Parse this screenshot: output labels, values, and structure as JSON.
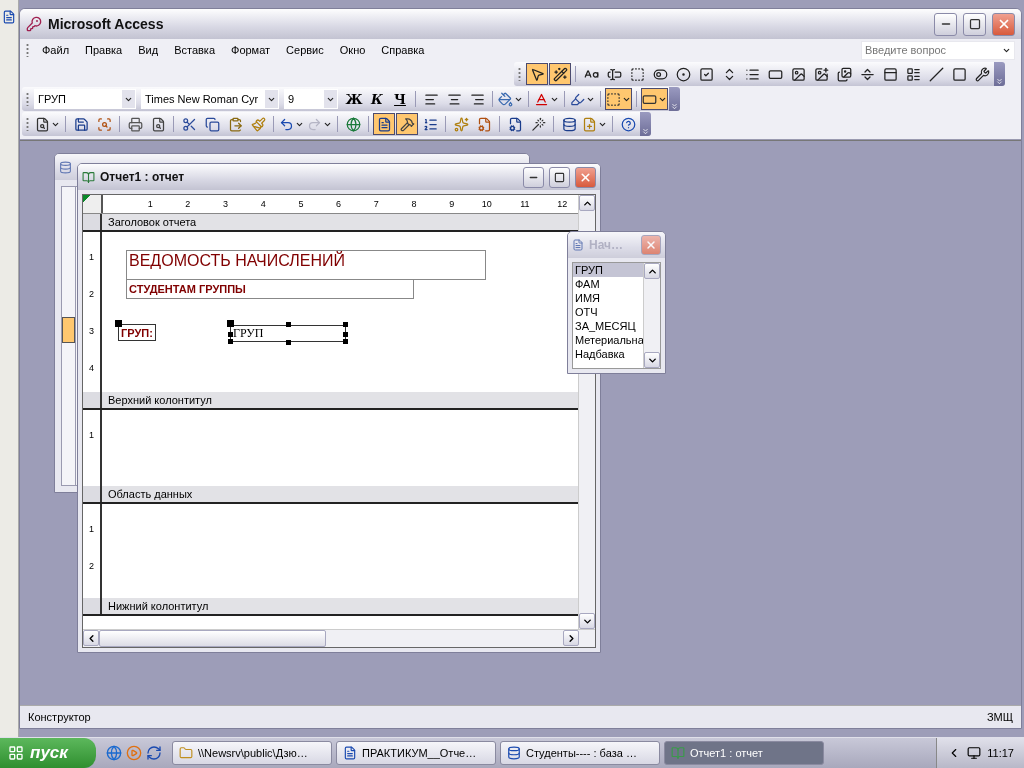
{
  "window": {
    "title": "Microsoft Access"
  },
  "menu": [
    "Файл",
    "Правка",
    "Вид",
    "Вставка",
    "Формат",
    "Сервис",
    "Окно",
    "Справка"
  ],
  "help_search": {
    "placeholder": "Введите вопрос"
  },
  "toolbox": [
    {
      "kind": "pointer",
      "selected": true
    },
    {
      "kind": "wizard",
      "selected": true
    },
    {
      "kind": "label",
      "selected": false
    },
    {
      "kind": "textbox",
      "selected": false
    },
    {
      "kind": "option-group",
      "selected": false
    },
    {
      "kind": "toggle",
      "selected": false
    },
    {
      "kind": "radio",
      "selected": false
    },
    {
      "kind": "checkbox",
      "selected": false
    },
    {
      "kind": "combo",
      "selected": false
    },
    {
      "kind": "listbox",
      "selected": false
    },
    {
      "kind": "command",
      "selected": false
    },
    {
      "kind": "image",
      "selected": false
    },
    {
      "kind": "unbound-frame",
      "selected": false
    },
    {
      "kind": "bound-frame",
      "selected": false
    },
    {
      "kind": "page-break",
      "selected": false
    },
    {
      "kind": "tab-control",
      "selected": false
    },
    {
      "kind": "subform",
      "selected": false
    },
    {
      "kind": "line",
      "selected": false
    },
    {
      "kind": "rectangle",
      "selected": false
    },
    {
      "kind": "more-tools",
      "selected": false
    }
  ],
  "formatting": {
    "object": "ГРУП",
    "font": "Times New Roman Cyr",
    "size": "9",
    "styles": [
      {
        "label": "Ж",
        "kind": "bold"
      },
      {
        "label": "К",
        "kind": "italic"
      },
      {
        "label": "Ч",
        "kind": "underline"
      }
    ],
    "tools": [
      {
        "kind": "align-left",
        "selected": false,
        "dropdown": false
      },
      {
        "kind": "align-center",
        "selected": false,
        "dropdown": false
      },
      {
        "kind": "align-right",
        "selected": false,
        "dropdown": false
      },
      {
        "kind": "fill-color",
        "selected": false,
        "dropdown": true
      },
      {
        "kind": "font-color",
        "selected": false,
        "dropdown": true
      },
      {
        "kind": "line-color",
        "selected": false,
        "dropdown": true
      },
      {
        "kind": "border",
        "selected": true,
        "dropdown": true
      },
      {
        "kind": "special-effect",
        "selected": true,
        "dropdown": true
      }
    ]
  },
  "design_toolbar": [
    {
      "kind": "view",
      "selected": false,
      "dropdown": true,
      "disabled": false
    },
    {
      "kind": "save",
      "selected": false,
      "dropdown": false,
      "disabled": false
    },
    {
      "kind": "file-search",
      "selected": false,
      "dropdown": false,
      "disabled": false
    },
    {
      "kind": "print",
      "selected": false,
      "dropdown": false,
      "disabled": false
    },
    {
      "kind": "preview",
      "selected": false,
      "dropdown": false,
      "disabled": false
    },
    {
      "kind": "cut",
      "selected": false,
      "dropdown": false,
      "disabled": false
    },
    {
      "kind": "copy",
      "selected": false,
      "dropdown": false,
      "disabled": false
    },
    {
      "kind": "paste",
      "selected": false,
      "dropdown": false,
      "disabled": false
    },
    {
      "kind": "format-painter",
      "selected": false,
      "dropdown": false,
      "disabled": false
    },
    {
      "kind": "undo",
      "selected": false,
      "dropdown": true,
      "disabled": false
    },
    {
      "kind": "redo",
      "selected": false,
      "dropdown": true,
      "disabled": true
    },
    {
      "kind": "hyperlink",
      "selected": false,
      "dropdown": false,
      "disabled": false
    },
    {
      "kind": "field-list",
      "selected": true,
      "dropdown": false,
      "disabled": false
    },
    {
      "kind": "toolbox",
      "selected": true,
      "dropdown": false,
      "disabled": false
    },
    {
      "kind": "sorting",
      "selected": false,
      "dropdown": false,
      "disabled": false
    },
    {
      "kind": "autoformat",
      "selected": false,
      "dropdown": false,
      "disabled": false
    },
    {
      "kind": "code",
      "selected": false,
      "dropdown": false,
      "disabled": false
    },
    {
      "kind": "properties",
      "selected": false,
      "dropdown": false,
      "disabled": false
    },
    {
      "kind": "build",
      "selected": false,
      "dropdown": false,
      "disabled": false
    },
    {
      "kind": "database",
      "selected": false,
      "dropdown": false,
      "disabled": false
    },
    {
      "kind": "new-object",
      "selected": false,
      "dropdown": true,
      "disabled": false
    },
    {
      "kind": "help",
      "selected": false,
      "dropdown": false,
      "disabled": false
    }
  ],
  "report_window": {
    "title": "Отчет1 : отчет",
    "ruler": [
      "1",
      "2",
      "3",
      "4",
      "5",
      "6",
      "7",
      "8",
      "9",
      "10",
      "11",
      "12"
    ],
    "sections": [
      {
        "title": "Заголовок отчета",
        "ruler": [
          "1",
          "2",
          "3",
          "4"
        ],
        "controls": [
          {
            "kind": "heading",
            "text": "ВЕДОМОСТЬ НАЧИСЛЕНИЙ",
            "selected": false
          },
          {
            "kind": "subheading",
            "text": "СТУДЕНТАМ ГРУППЫ",
            "selected": false
          },
          {
            "kind": "label",
            "text": "ГРУП:",
            "selected": true
          },
          {
            "kind": "textbox",
            "text": "ГРУП",
            "selected": true
          }
        ]
      },
      {
        "title": "Верхний колонтитул",
        "ruler": [
          "1"
        ]
      },
      {
        "title": "Область данных",
        "ruler": [
          "1",
          "2"
        ]
      },
      {
        "title": "Нижний колонтитул"
      }
    ]
  },
  "field_list": {
    "title": "Нач…",
    "fields": [
      {
        "name": "ГРУП",
        "selected": true
      },
      {
        "name": "ФАМ",
        "selected": false
      },
      {
        "name": "ИМЯ",
        "selected": false
      },
      {
        "name": "ОТЧ",
        "selected": false
      },
      {
        "name": "ЗА_МЕСЯЦ",
        "selected": false
      },
      {
        "name": "Метериальна",
        "selected": false
      },
      {
        "name": "Надбавка",
        "selected": false
      }
    ]
  },
  "status_bar": {
    "mode": "Конструктор",
    "indicator": "ЗМЩ"
  },
  "taskbar": {
    "start": "пуск",
    "tasks": [
      {
        "label": "\\\\Newsrv\\public\\Дзю…",
        "kind": "folder",
        "selected": false
      },
      {
        "label": "ПРАКТИКУМ__Отче…",
        "kind": "document",
        "selected": false
      },
      {
        "label": "Студенты---- : база …",
        "kind": "database",
        "selected": false
      },
      {
        "label": "Отчет1 : отчет",
        "kind": "report",
        "selected": true
      }
    ],
    "clock": "11:17"
  }
}
